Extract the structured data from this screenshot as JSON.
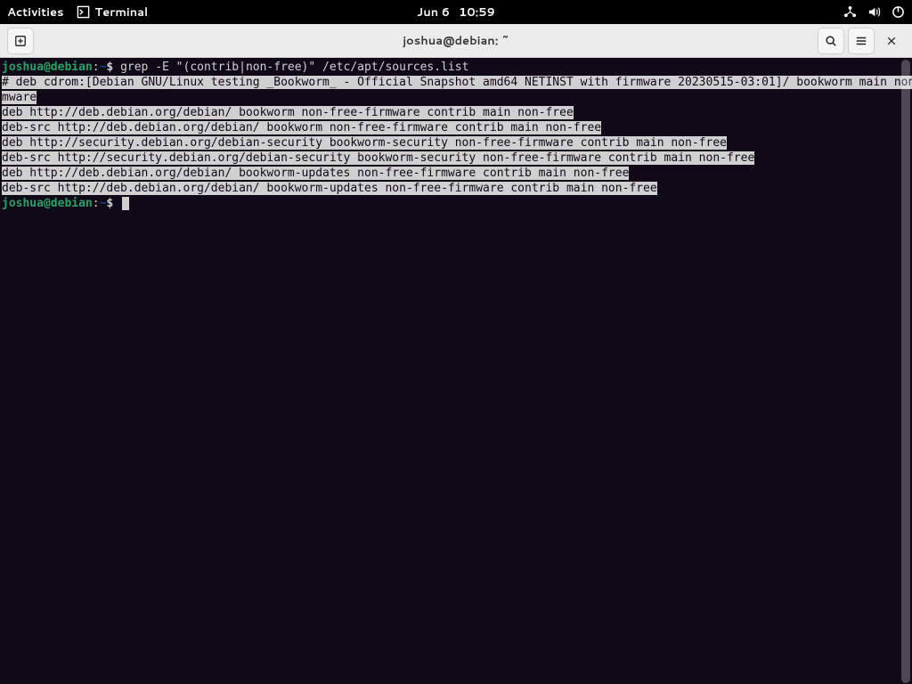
{
  "topbar": {
    "activities": "Activities",
    "app_name": "Terminal",
    "date": "Jun 6",
    "time": "10:59"
  },
  "window": {
    "title": "joshua@debian: ~"
  },
  "terminal": {
    "prompt_user": "joshua@debian",
    "prompt_sep": ":",
    "prompt_path": "~",
    "prompt_symbol": "$ ",
    "command": "grep -E \"(contrib|non-free)\" /etc/apt/sources.list",
    "output_comment_1": "# deb cdrom:[Debian GNU/Linux testing _Bookworm_ - Official Snapshot amd64 NETINST with firmware 20230515-03:01]/ bookworm main non-free-fir",
    "output_comment_2": "mware",
    "matches": [
      "deb http://deb.debian.org/debian/ bookworm non-free-firmware contrib main non-free",
      "deb-src http://deb.debian.org/debian/ bookworm non-free-firmware contrib main non-free",
      "deb http://security.debian.org/debian-security bookworm-security non-free-firmware contrib main non-free",
      "deb-src http://security.debian.org/debian-security bookworm-security non-free-firmware contrib main non-free",
      "deb http://deb.debian.org/debian/ bookworm-updates non-free-firmware contrib main non-free",
      "deb-src http://deb.debian.org/debian/ bookworm-updates non-free-firmware contrib main non-free"
    ]
  },
  "icons": {
    "terminal": "terminal-icon",
    "network": "network-icon",
    "volume": "volume-icon",
    "power": "power-icon",
    "new_tab": "new-tab-icon",
    "search": "search-icon",
    "menu": "hamburger-menu-icon",
    "close": "close-icon"
  }
}
